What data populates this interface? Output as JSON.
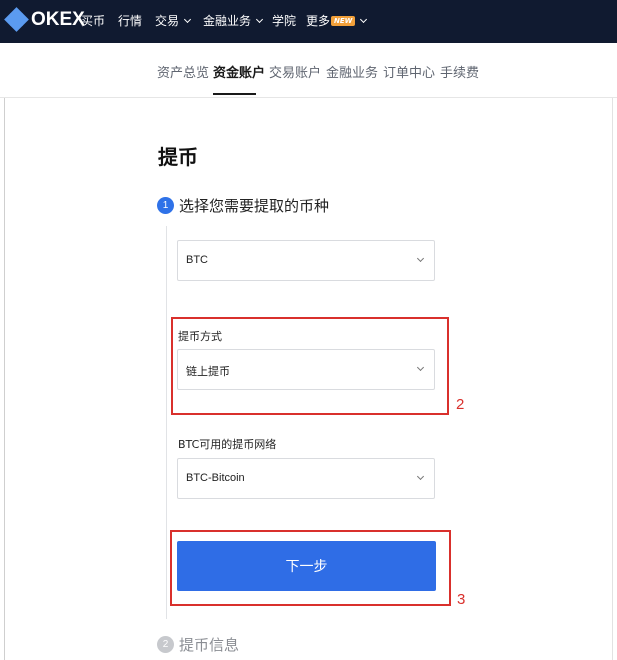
{
  "brand": {
    "logo_text": "OKEX"
  },
  "topnav": {
    "items": [
      {
        "label": "买币"
      },
      {
        "label": "行情"
      },
      {
        "label": "交易"
      },
      {
        "label": "金融业务"
      },
      {
        "label": "学院"
      },
      {
        "label": "更多"
      }
    ],
    "new_badge": "NEW"
  },
  "subnav": {
    "tabs": [
      {
        "label": "资产总览"
      },
      {
        "label": "资金账户"
      },
      {
        "label": "交易账户"
      },
      {
        "label": "金融业务"
      },
      {
        "label": "订单中心"
      },
      {
        "label": "手续费"
      }
    ],
    "active_tab": "资金账户"
  },
  "page": {
    "title": "提币"
  },
  "steps": [
    {
      "number": "1",
      "label": "选择您需要提取的币种",
      "state": "active"
    },
    {
      "number": "2",
      "label": "提币信息",
      "state": "inactive"
    }
  ],
  "form": {
    "coin_select": {
      "value": "BTC"
    },
    "method": {
      "label": "提币方式",
      "value": "链上提币"
    },
    "network": {
      "label": "BTC可用的提币网络",
      "value": "BTC-Bitcoin"
    },
    "next_button": "下一步"
  },
  "annotations": [
    {
      "number": "2"
    },
    {
      "number": "3"
    }
  ],
  "colors": {
    "topnav_bg": "#101a30",
    "primary": "#2f6de6",
    "annotation": "#d9302c"
  }
}
